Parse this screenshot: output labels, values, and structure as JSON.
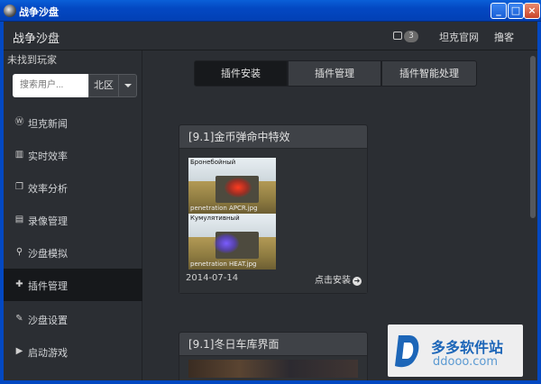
{
  "window": {
    "title": "战争沙盘",
    "min_label": "_",
    "max_label": "□",
    "close_label": "×"
  },
  "header": {
    "brand": "战争沙盘",
    "message_count": "3",
    "link_official": "坦克官网",
    "link_blog": "撸客"
  },
  "sidebar": {
    "not_found": "未找到玩家",
    "search_placeholder": "搜索用户...",
    "region": "北区",
    "items": [
      {
        "label": "坦克新闻",
        "icon": "wordpress-icon"
      },
      {
        "label": "实时效率",
        "icon": "bar-chart-icon"
      },
      {
        "label": "效率分析",
        "icon": "clipboard-icon"
      },
      {
        "label": "录像管理",
        "icon": "film-icon"
      },
      {
        "label": "沙盘模拟",
        "icon": "map-marker-icon"
      },
      {
        "label": "插件管理",
        "icon": "puzzle-icon"
      },
      {
        "label": "沙盘设置",
        "icon": "wrench-icon"
      },
      {
        "label": "启动游戏",
        "icon": "play-icon"
      }
    ]
  },
  "tabs": [
    "插件安装",
    "插件管理",
    "插件智能处理"
  ],
  "cards": [
    {
      "title": "[9.1]金币弹命中特效",
      "caption1": "Бронебойный",
      "caption2": "Кумулятивный",
      "foot1": "penetration APCR.jpg",
      "foot2": "penetration HEAT.jpg",
      "date": "2014-07-14",
      "install": "点击安装"
    },
    {
      "title": "[9.1]冬日车库界面"
    }
  ],
  "watermark": {
    "name": "多多软件站",
    "url": "ddooo.com"
  },
  "colors": {
    "titlebar": "#0348c2",
    "active_nav": "#16181b",
    "panel": "#2b2e33",
    "card": "#3a3d42"
  }
}
